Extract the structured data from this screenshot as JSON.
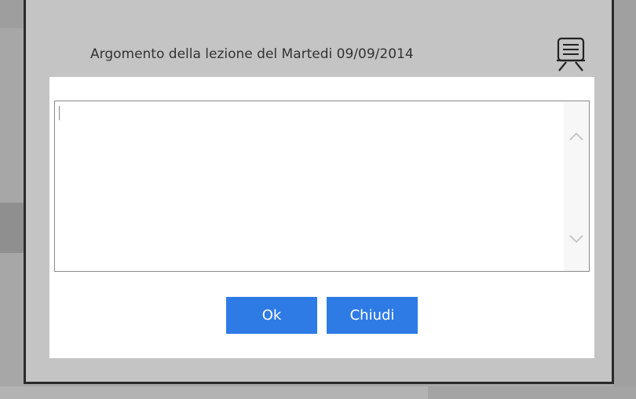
{
  "dialog": {
    "title": "Argomento della lezione del Martedi 09/09/2014",
    "header_icon": "presentation-board-icon",
    "textarea_value": "",
    "textarea_placeholder": ""
  },
  "buttons": {
    "ok_label": "Ok",
    "close_label": "Chiudi"
  },
  "colors": {
    "accent": "#2e7be6",
    "header_bg": "#c4c4c4",
    "frame_border": "#2a2a2a"
  }
}
